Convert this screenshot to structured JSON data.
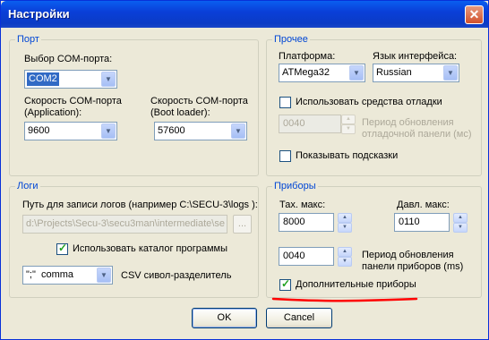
{
  "window": {
    "title": "Настройки",
    "close_glyph": "✕"
  },
  "port": {
    "legend": "Порт",
    "com_label": "Выбор COM-порта:",
    "com_value": "COM2",
    "app_speed_label_1": "Скорость COM-порта",
    "app_speed_label_2": "(Application):",
    "app_speed_value": "9600",
    "boot_speed_label_1": "Скорость COM-порта",
    "boot_speed_label_2": "(Boot loader):",
    "boot_speed_value": "57600"
  },
  "misc": {
    "legend": "Прочее",
    "platform_label": "Платформа:",
    "platform_value": "ATMega32",
    "lang_label": "Язык интерфейса:",
    "lang_value": "Russian",
    "debug_checkbox_label": "Использовать средства отладки",
    "debug_checked": false,
    "debug_period_value": "0040",
    "debug_period_label_1": "Период обновления",
    "debug_period_label_2": "отладочной панели (мс)",
    "hints_checkbox_label": "Показывать подсказки",
    "hints_checked": false
  },
  "logs": {
    "legend": "Логи",
    "path_label": "Путь для записи логов (например C:\\SECU-3\\logs ):",
    "path_value": "d:\\Projects\\Secu-3\\secu3man\\intermediate\\se",
    "browse_label": "...",
    "use_app_dir_label": "Использовать каталог программы",
    "use_app_dir_checked": true,
    "csv_value": "\";\"  comma",
    "csv_label": "CSV сивол-разделитель"
  },
  "gauges": {
    "legend": "Приборы",
    "tach_label": "Тах. макс:",
    "tach_value": "8000",
    "press_label": "Давл. макс:",
    "press_value": "0110",
    "period_value": "0040",
    "period_label_1": "Период обновления",
    "period_label_2": "панели приборов (ms)",
    "extra_label": "Дополнительные приборы",
    "extra_checked": true
  },
  "buttons": {
    "ok": "OK",
    "cancel": "Cancel"
  },
  "icons": {
    "dropdown": "chevron-down-icon",
    "spin_up": "spin-up-icon",
    "spin_down": "spin-down-icon",
    "check": "check-icon",
    "close": "close-icon"
  },
  "colors": {
    "accent": "#0046d5",
    "title_bar": "#0a3fd8",
    "underline": "#ff0000",
    "selection": "#316ac5",
    "check": "#21a121"
  }
}
